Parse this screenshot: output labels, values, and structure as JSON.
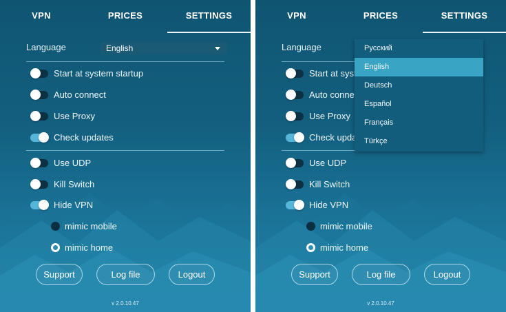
{
  "tabs": [
    "VPN",
    "PRICES",
    "SETTINGS"
  ],
  "active_tab": "SETTINGS",
  "language": {
    "label": "Language",
    "selected": "English",
    "options": [
      "Русский",
      "English",
      "Deutsch",
      "Español",
      "Français",
      "Türkçe"
    ]
  },
  "toggles": [
    {
      "label": "Start at system startup",
      "on": false
    },
    {
      "label": "Auto connect",
      "on": false
    },
    {
      "label": "Use Proxy",
      "on": false
    },
    {
      "label": "Check updates",
      "on": true
    },
    {
      "label": "Use UDP",
      "on": false
    },
    {
      "label": "Kill Switch",
      "on": false
    },
    {
      "label": "Hide VPN",
      "on": true
    }
  ],
  "radios": [
    {
      "label": "mimic mobile",
      "selected": false
    },
    {
      "label": "mimic home",
      "selected": true
    }
  ],
  "buttons": {
    "support": "Support",
    "log_file": "Log file",
    "logout": "Logout"
  },
  "version": "v 2.0.10.47",
  "colors": {
    "background_top": "#0f5572",
    "background_bottom": "#2b8fb3",
    "toggle_on": "#55b6d9",
    "dropdown_highlight": "#3aa4c5"
  }
}
